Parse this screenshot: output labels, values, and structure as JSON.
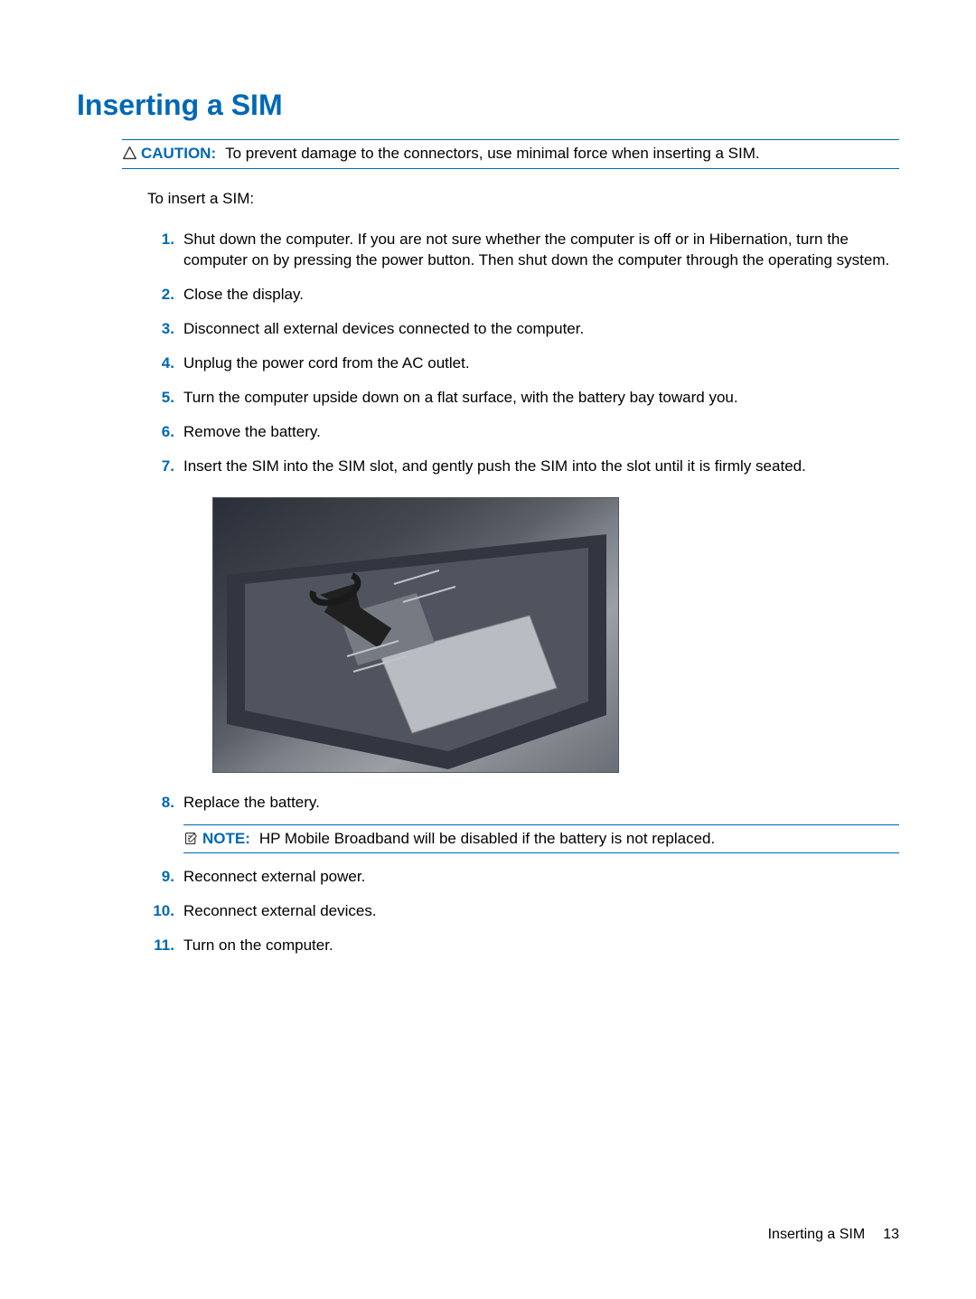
{
  "title": "Inserting a SIM",
  "caution": {
    "label": "CAUTION:",
    "text": "To prevent damage to the connectors, use minimal force when inserting a SIM."
  },
  "intro": "To insert a SIM:",
  "steps": [
    {
      "num": "1",
      "text": "Shut down the computer. If you are not sure whether the computer is off or in Hibernation, turn the computer on by pressing the power button. Then shut down the computer through the operating system."
    },
    {
      "num": "2",
      "text": "Close the display."
    },
    {
      "num": "3",
      "text": "Disconnect all external devices connected to the computer."
    },
    {
      "num": "4",
      "text": "Unplug the power cord from the AC outlet."
    },
    {
      "num": "5",
      "text": "Turn the computer upside down on a flat surface, with the battery bay toward you."
    },
    {
      "num": "6",
      "text": "Remove the battery."
    },
    {
      "num": "7",
      "text": "Insert the SIM into the SIM slot, and gently push the SIM into the slot until it is firmly seated."
    },
    {
      "num": "8",
      "text": "Replace the battery."
    },
    {
      "num": "9",
      "text": "Reconnect external power."
    },
    {
      "num": "10",
      "text": "Reconnect external devices."
    },
    {
      "num": "11",
      "text": "Turn on the computer."
    }
  ],
  "note": {
    "label": "NOTE:",
    "text": "HP Mobile Broadband will be disabled if the battery is not replaced."
  },
  "image_alt": "Illustration of inserting SIM into battery bay slot",
  "footer": {
    "section": "Inserting a SIM",
    "page": "13"
  }
}
